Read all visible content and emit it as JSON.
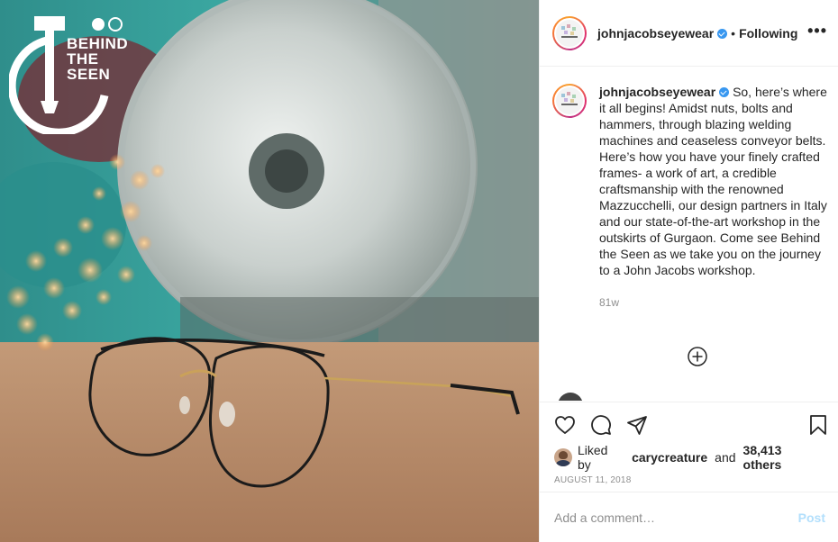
{
  "media": {
    "brand_lines": [
      "BEHIND",
      "THE",
      "SEEN"
    ],
    "alt": "eyeglasses on a wooden workbench"
  },
  "header": {
    "username": "johnjacobseyewear",
    "separator": "•",
    "follow_status": "Following",
    "more_icon": "more-horizontal-icon"
  },
  "caption": {
    "username": "johnjacobseyewear",
    "text": "So, here’s where it all begins! Amidst nuts, bolts and hammers, through blazing welding machines and ceaseless conveyor belts. Here’s how you have your finely crafted frames- a work of art, a credible craftsmanship with the renowned Mazzucchelli, our design partners in Italy and our state-of-the-art workshop in the outskirts of Gurgaon. Come see Behind the Seen as we take you on the journey to a John Jacobs workshop.",
    "time_ago": "81w"
  },
  "actions": {
    "icons": [
      "heart-icon",
      "comment-icon",
      "share-icon",
      "bookmark-icon"
    ]
  },
  "likes": {
    "prefix": "Liked by",
    "user": "carycreature",
    "conj": "and",
    "count": "38,413 others"
  },
  "post_date": "AUGUST 11, 2018",
  "comment": {
    "placeholder": "Add a comment…",
    "post_label": "Post"
  },
  "colors": {
    "verified": "#3897f0",
    "post_disabled": "#b2dffc",
    "muted": "#8e8e8e"
  }
}
